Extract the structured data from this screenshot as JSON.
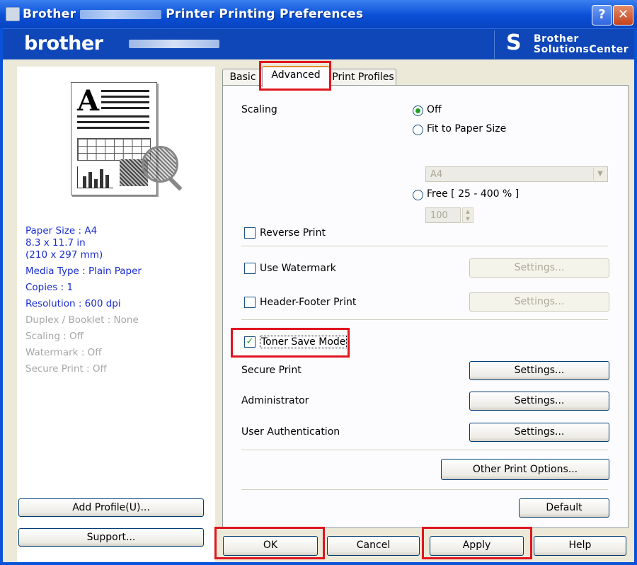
{
  "window": {
    "title_prefix": "Brother",
    "title_suffix": "Printer Printing Preferences",
    "help_label": "?",
    "close_label": "✕"
  },
  "brand": {
    "logo": "brother",
    "solutions_line1": "Brother",
    "solutions_line2": "SolutionsCenter"
  },
  "summary": {
    "paper_size": "Paper Size : A4",
    "paper_dims_in": "8.3 x 11.7 in",
    "paper_dims_mm": "(210 x 297 mm)",
    "media_type": "Media Type : Plain Paper",
    "copies": "Copies : 1",
    "resolution": "Resolution : 600 dpi",
    "duplex": "Duplex / Booklet : None",
    "scaling": "Scaling : Off",
    "watermark": "Watermark : Off",
    "secure_print": "Secure Print : Off"
  },
  "left_buttons": {
    "add_profile": "Add Profile(U)...",
    "support": "Support..."
  },
  "tabs": [
    "Basic",
    "Advanced",
    "Print Profiles"
  ],
  "active_tab": "Advanced",
  "scaling": {
    "label": "Scaling",
    "off": "Off",
    "fit": "Fit to Paper Size",
    "paper_value": "A4",
    "free": "Free [ 25 - 400 % ]",
    "free_value": "100",
    "selected": "Off"
  },
  "options": {
    "reverse_print": "Reverse Print",
    "use_watermark": "Use Watermark",
    "header_footer": "Header-Footer Print",
    "toner_save": "Toner Save Mode",
    "toner_save_checked": true,
    "secure_print": "Secure Print",
    "administrator": "Administrator",
    "user_auth": "User Authentication"
  },
  "buttons": {
    "settings": "Settings...",
    "other_print_options": "Other Print Options...",
    "default": "Default",
    "ok": "OK",
    "cancel": "Cancel",
    "apply": "Apply",
    "help": "Help"
  },
  "colors": {
    "title_bar": "#0a4fd6",
    "highlight": "#e0151f",
    "summary_text": "#1a2cd0",
    "check_green": "#21a121"
  }
}
